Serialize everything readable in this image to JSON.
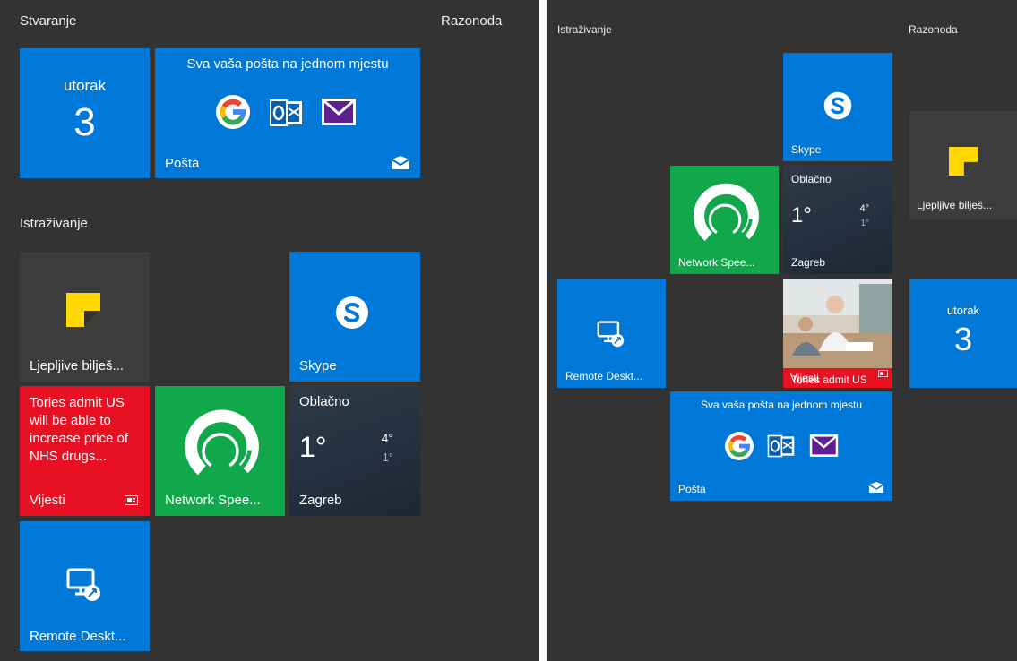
{
  "left_view": {
    "group_titles": {
      "stvaranje": "Stvaranje",
      "razonoda": "Razonoda",
      "istrazivanje": "Istraživanje"
    },
    "calendar": {
      "day_name": "utorak",
      "day_number": "3"
    },
    "mail": {
      "header": "Sva vaša pošta na jednom mjestu",
      "label": "Pošta"
    },
    "sticky_notes": {
      "label": "Ljepljive bilješ..."
    },
    "skype": {
      "label": "Skype"
    },
    "news": {
      "headline": "Tories admit US will be able to increase price of NHS drugs...",
      "label": "Vijesti"
    },
    "network_speed": {
      "label": "Network Spee..."
    },
    "weather": {
      "condition": "Oblačno",
      "temperature": "1°",
      "high": "4°",
      "low": "1°",
      "city": "Zagreb"
    },
    "remote_desktop": {
      "label": "Remote Deskt..."
    }
  },
  "right_view": {
    "group_titles": {
      "istrazivanje": "Istraživanje",
      "razonoda": "Razonoda"
    },
    "skype": {
      "label": "Skype"
    },
    "sticky_notes": {
      "label": "Ljepljive bilješ..."
    },
    "network_speed": {
      "label": "Network Spee..."
    },
    "weather": {
      "condition": "Oblačno",
      "temperature": "1°",
      "high": "4°",
      "low": "1°",
      "city": "Zagreb"
    },
    "remote_desktop": {
      "label": "Remote Deskt..."
    },
    "news": {
      "label": "Vijesti",
      "headline_overlay": "Tories admit US"
    },
    "calendar": {
      "day_name": "utorak",
      "day_number": "3"
    },
    "mail": {
      "header": "Sva vaša pošta na jednom mjestu",
      "label": "Pošta"
    }
  },
  "colors": {
    "background": "#333333",
    "tile_blue": "#0078d7",
    "tile_green": "#11a84b",
    "tile_red": "#e81123",
    "sticky_yellow": "#ffd800",
    "outlook_blue": "#0364b8",
    "mail_purple": "#5e1f8f"
  },
  "icons": [
    "google-icon",
    "outlook-icon",
    "mail-envelope-icon",
    "sticky-note-icon",
    "skype-icon",
    "network-speed-gauge-icon",
    "remote-desktop-icon",
    "news-badge-icon"
  ]
}
